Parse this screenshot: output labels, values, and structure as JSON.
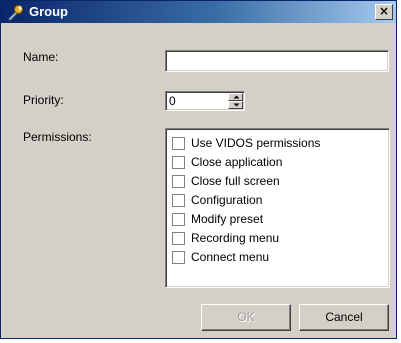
{
  "window": {
    "title": "Group",
    "close_glyph": "×",
    "icon": "wrench-icon"
  },
  "form": {
    "name_label": "Name:",
    "name_value": "",
    "priority_label": "Priority:",
    "priority_value": "0",
    "permissions_label": "Permissions:"
  },
  "permissions": [
    {
      "label": "Use VIDOS permissions",
      "checked": false
    },
    {
      "label": "Close application",
      "checked": false
    },
    {
      "label": "Close full screen",
      "checked": false
    },
    {
      "label": "Configuration",
      "checked": false
    },
    {
      "label": "Modify preset",
      "checked": false
    },
    {
      "label": "Recording menu",
      "checked": false
    },
    {
      "label": "Connect menu",
      "checked": false
    }
  ],
  "buttons": {
    "ok_label": "OK",
    "ok_enabled": false,
    "cancel_label": "Cancel"
  },
  "colors": {
    "titlebar_start": "#0a246a",
    "titlebar_end": "#a6caf0",
    "dialog_bg": "#d4d0c8"
  }
}
